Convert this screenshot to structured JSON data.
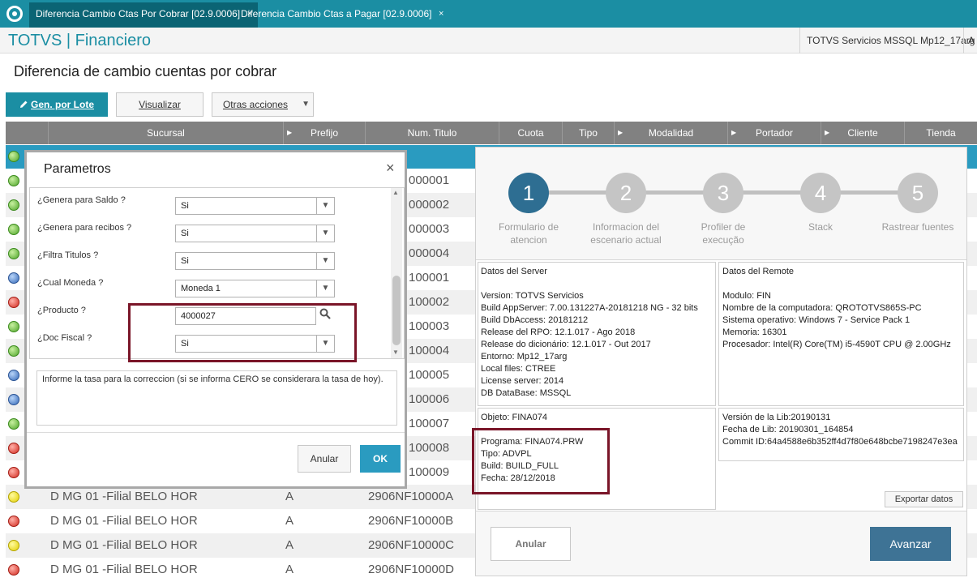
{
  "tabs": [
    {
      "label": "Diferencia Cambio Ctas Por Cobrar [02.9.0006]",
      "close": "×"
    },
    {
      "label": "Diferencia Cambio Ctas a Pagar [02.9.0006]",
      "close": "×"
    }
  ],
  "header": {
    "brand": "TOTVS | Financiero",
    "environment": "TOTVS Servicios MSSQL Mp12_17arg",
    "user_initial": "A"
  },
  "page": {
    "title": "Diferencia de cambio cuentas por cobrar"
  },
  "toolbar": {
    "gen_lote": "Gen. por Lote",
    "visualizar": "Visualizar",
    "otras": "Otras acciones",
    "otras_caret": "▼"
  },
  "grid": {
    "columns": [
      "Sucursal",
      "Prefijo",
      "Num. Titulo",
      "Cuota",
      "Tipo",
      "Modalidad",
      "Portador",
      "Cliente",
      "Tienda"
    ],
    "caret": "▶",
    "status_colors": {
      "green": "#4fa52a",
      "blue": "#3469b8",
      "red": "#d22b20",
      "yellow": "#e3d000"
    },
    "rows": [
      {
        "status": "green",
        "sucursal": "",
        "prefijo": "",
        "num": "000001"
      },
      {
        "status": "green",
        "sucursal": "",
        "prefijo": "",
        "num": "000002"
      },
      {
        "status": "green",
        "sucursal": "",
        "prefijo": "",
        "num": "000003"
      },
      {
        "status": "green",
        "sucursal": "",
        "prefijo": "",
        "num": "000004"
      },
      {
        "status": "blue",
        "sucursal": "",
        "prefijo": "",
        "num": "100001"
      },
      {
        "status": "red",
        "sucursal": "",
        "prefijo": "",
        "num": "100002"
      },
      {
        "status": "green",
        "sucursal": "",
        "prefijo": "",
        "num": "100003"
      },
      {
        "status": "green",
        "sucursal": "",
        "prefijo": "",
        "num": "100004"
      },
      {
        "status": "blue",
        "sucursal": "",
        "prefijo": "",
        "num": "100005"
      },
      {
        "status": "blue",
        "sucursal": "",
        "prefijo": "",
        "num": "100006"
      },
      {
        "status": "green",
        "sucursal": "",
        "prefijo": "",
        "num": "100007"
      },
      {
        "status": "red",
        "sucursal": "",
        "prefijo": "",
        "num": "100008"
      },
      {
        "status": "red",
        "sucursal": "",
        "prefijo": "",
        "num": "100009"
      },
      {
        "status": "yellow",
        "sucursal": "D MG 01 -Filial BELO HOR",
        "prefijo": "A",
        "num": "2906NF10000A"
      },
      {
        "status": "red",
        "sucursal": "D MG 01 -Filial BELO HOR",
        "prefijo": "A",
        "num": "2906NF10000B"
      },
      {
        "status": "yellow",
        "sucursal": "D MG 01 -Filial BELO HOR",
        "prefijo": "A",
        "num": "2906NF10000C"
      },
      {
        "status": "red",
        "sucursal": "D MG 01 -Filial BELO HOR",
        "prefijo": "A",
        "num": "2906NF10000D"
      }
    ]
  },
  "dialog": {
    "title": "Parametros",
    "close": "×",
    "params": [
      {
        "label": "¿Genera para Saldo ?",
        "value": "Si"
      },
      {
        "label": "¿Genera para recibos ?",
        "value": "Si"
      },
      {
        "label": "¿Filtra Titulos ?",
        "value": "Si"
      },
      {
        "label": "¿Cual Moneda ?",
        "value": "Moneda 1"
      },
      {
        "label": "¿Producto ?",
        "value": "4000027"
      },
      {
        "label": "¿Doc Fiscal ?",
        "value": "Si"
      }
    ],
    "dropdown_arrow": "▼",
    "scroll_up": "▲",
    "scroll_down": "▼",
    "help": "Informe la tasa para la correccion (si se informa CERO se considerara la tasa de hoy).",
    "anular": "Anular",
    "ok": "OK"
  },
  "panel": {
    "steps": [
      {
        "num": "1",
        "label1": "Formulario de",
        "label2": "atencion"
      },
      {
        "num": "2",
        "label1": "Informacion del",
        "label2": "escenario actual"
      },
      {
        "num": "3",
        "label1": "Profiler de",
        "label2": "execução"
      },
      {
        "num": "4",
        "label1": "Stack",
        "label2": ""
      },
      {
        "num": "5",
        "label1": "Rastrear fuentes",
        "label2": ""
      }
    ],
    "server": {
      "title": "Datos del Server",
      "lines": [
        "Version: TOTVS Servicios",
        "Build AppServer: 7.00.131227A-20181218 NG - 32 bits",
        "Build DbAccess: 20181212",
        "Release del RPO:  12.1.017 - Ago  2018",
        "Release do dicionário: 12.1.017 - Out  2017",
        "Entorno: Mp12_17arg",
        "Local files: CTREE",
        "License server: 2014",
        "DB DataBase: MSSQL"
      ]
    },
    "remote": {
      "title": "Datos del Remote",
      "lines": [
        "Modulo: FIN",
        "Nombre de la computadora: QROTOTVS865S-PC",
        "Sistema operativo: Windows 7 - Service Pack 1",
        "Memoria: 16301",
        "Procesador: Intel(R) Core(TM) i5-4590T CPU @ 2.00GHz"
      ]
    },
    "objeto": {
      "title": "Objeto: FINA074",
      "lines": [
        "Programa: FINA074.PRW",
        "Tipo: ADVPL",
        "Build: BUILD_FULL",
        "Fecha: 28/12/2018"
      ]
    },
    "lib": {
      "lines": [
        "Versión de la Lib:20190131",
        "Fecha de Lib: 20190301_164854",
        "Commit ID:64a4588e6b352ff4d7f80e648bcbe7198247e3ea"
      ]
    },
    "exportar": "Exportar datos",
    "anular": "Anular",
    "avanzar": "Avanzar"
  }
}
